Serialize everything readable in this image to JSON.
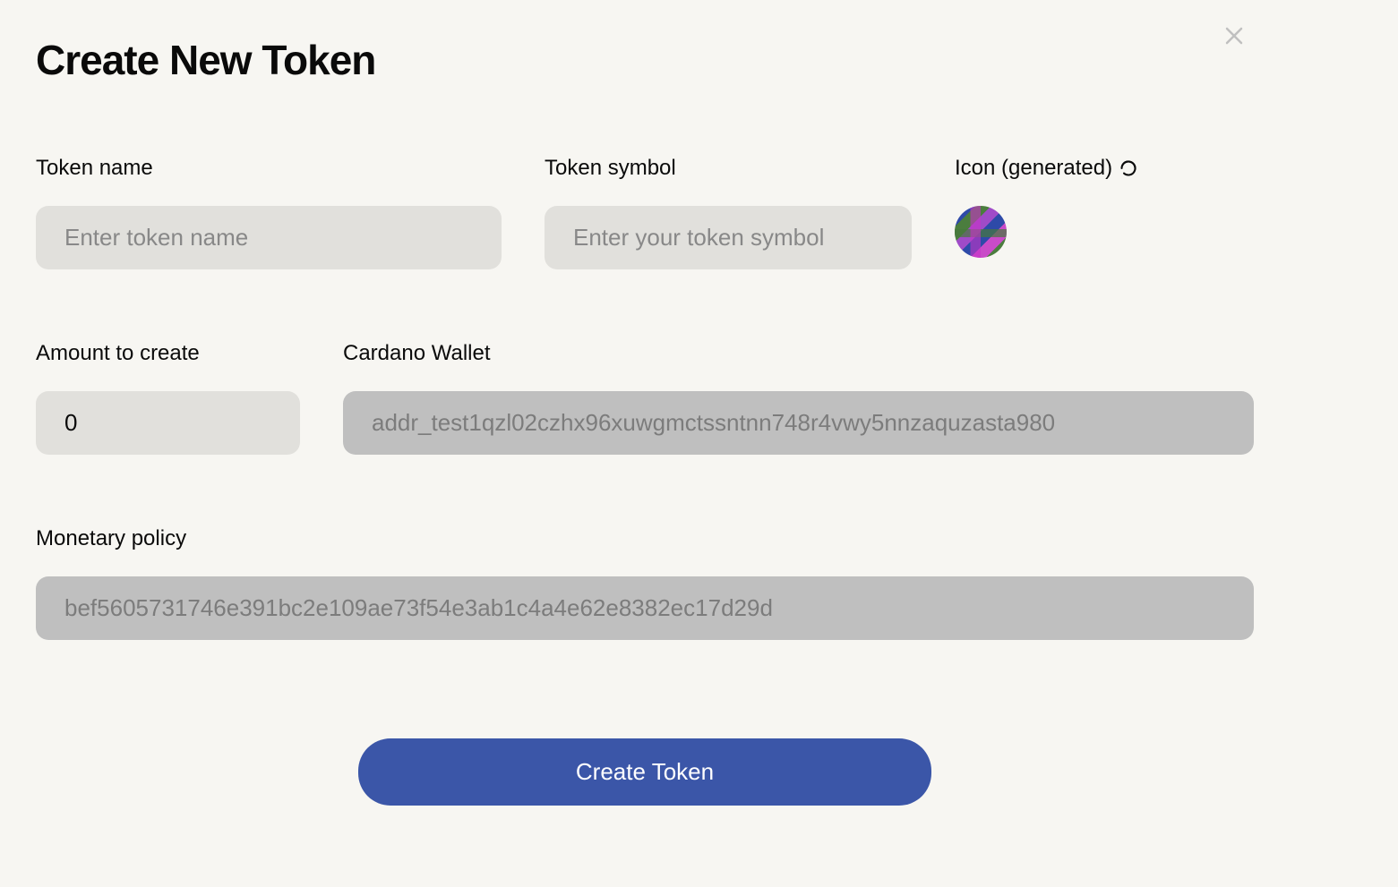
{
  "modal": {
    "title": "Create New Token"
  },
  "fields": {
    "token_name": {
      "label": "Token name",
      "placeholder": "Enter token name",
      "value": ""
    },
    "token_symbol": {
      "label": "Token symbol",
      "placeholder": "Enter your token symbol",
      "value": ""
    },
    "icon": {
      "label": "Icon (generated)"
    },
    "amount": {
      "label": "Amount to create",
      "value": "0"
    },
    "wallet": {
      "label": "Cardano Wallet",
      "value": "addr_test1qzl02czhx96xuwgmctssntnn748r4vwy5nnzaquzasta980"
    },
    "policy": {
      "label": "Monetary policy",
      "value": "bef5605731746e391bc2e109ae73f54e3ab1c4a4e62e8382ec17d29d"
    }
  },
  "actions": {
    "submit_label": "Create Token"
  }
}
